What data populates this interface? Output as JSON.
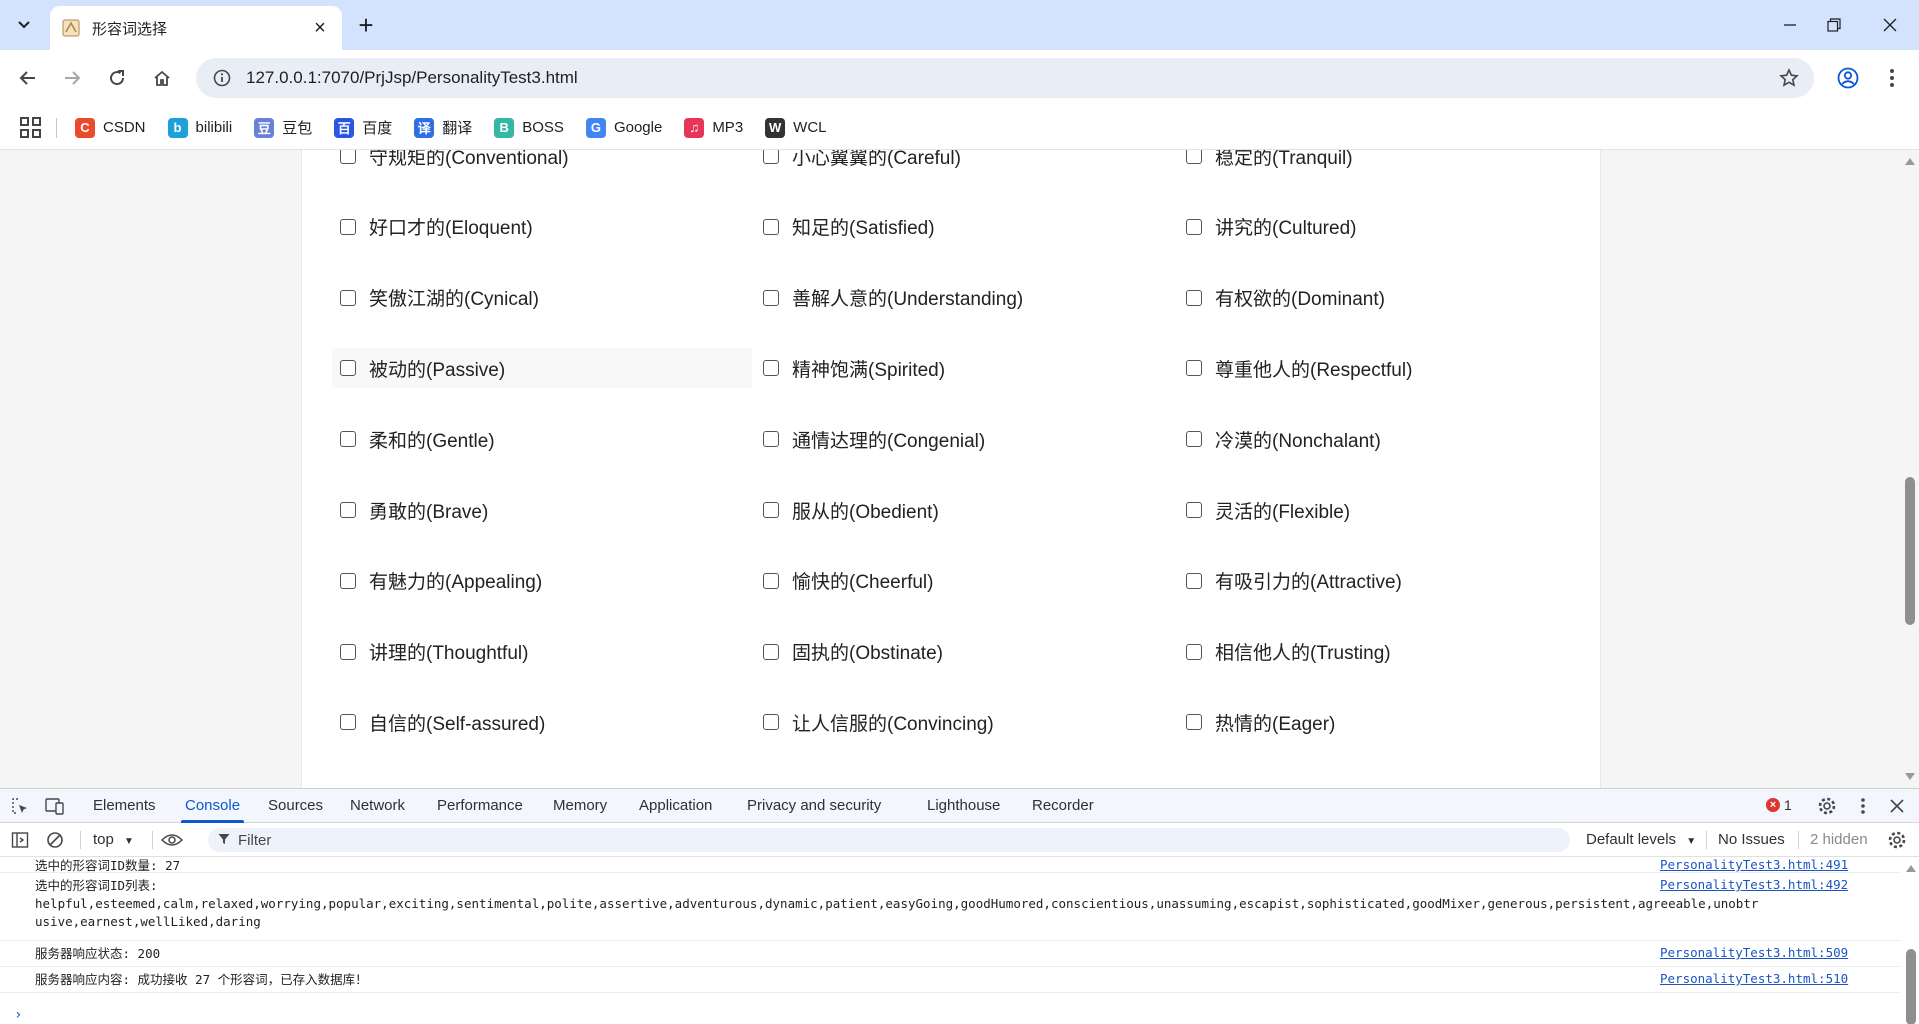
{
  "browser": {
    "tab_title": "形容词选择",
    "url": "127.0.0.1:7070/PrjJsp/PersonalityTest3.html"
  },
  "bookmarks": [
    {
      "label": "CSDN",
      "icon": "csdn-icon",
      "color": "#e94b2b",
      "glyph": "C"
    },
    {
      "label": "bilibili",
      "icon": "bilibili-icon",
      "color": "#1ea0d8",
      "glyph": "b"
    },
    {
      "label": "豆包",
      "icon": "doubao-icon",
      "color": "#6b7fd6",
      "glyph": "豆"
    },
    {
      "label": "百度",
      "icon": "baidu-icon",
      "color": "#2a55e5",
      "glyph": "百"
    },
    {
      "label": "翻译",
      "icon": "translate-icon",
      "color": "#2f6fe4",
      "glyph": "译"
    },
    {
      "label": "BOSS",
      "icon": "boss-icon",
      "color": "#33b7a6",
      "glyph": "B"
    },
    {
      "label": "Google",
      "icon": "google-icon",
      "color": "#4285f4",
      "glyph": "G"
    },
    {
      "label": "MP3",
      "icon": "music-icon",
      "color": "#e8365a",
      "glyph": "♫"
    },
    {
      "label": "WCL",
      "icon": "wcl-icon",
      "color": "#333333",
      "glyph": "W"
    }
  ],
  "adjectives": [
    [
      "守规矩的(Conventional)",
      "小心翼翼的(Careful)",
      "稳定的(Tranquil)"
    ],
    [
      "好口才的(Eloquent)",
      "知足的(Satisfied)",
      "讲究的(Cultured)"
    ],
    [
      "笑傲江湖的(Cynical)",
      "善解人意的(Understanding)",
      "有权欲的(Dominant)"
    ],
    [
      "被动的(Passive)",
      "精神饱满(Spirited)",
      "尊重他人的(Respectful)"
    ],
    [
      "柔和的(Gentle)",
      "通情达理的(Congenial)",
      "冷漠的(Nonchalant)"
    ],
    [
      "勇敢的(Brave)",
      "服从的(Obedient)",
      "灵活的(Flexible)"
    ],
    [
      "有魅力的(Appealing)",
      "愉快的(Cheerful)",
      "有吸引力的(Attractive)"
    ],
    [
      "讲理的(Thoughtful)",
      "固执的(Obstinate)",
      "相信他人的(Trusting)"
    ],
    [
      "自信的(Self-assured)",
      "让人信服的(Convincing)",
      "热情的(Eager)"
    ]
  ],
  "devtools": {
    "tabs": [
      "Elements",
      "Console",
      "Sources",
      "Network",
      "Performance",
      "Memory",
      "Application",
      "Privacy and security",
      "Lighthouse",
      "Recorder"
    ],
    "active_tab": "Console",
    "error_count": "1",
    "context": "top",
    "filter_placeholder": "Filter",
    "levels": "Default levels",
    "issues": "No Issues",
    "hidden": "2 hidden",
    "logs": [
      {
        "text": "选中的形容词ID数量: 27",
        "source": "PersonalityTest3.html:491"
      },
      {
        "text": "选中的形容词ID列表:\nhelpful,esteemed,calm,relaxed,worrying,popular,exciting,sentimental,polite,assertive,adventurous,dynamic,patient,easyGoing,goodHumored,conscientious,unassuming,escapist,sophisticated,goodMixer,generous,persistent,agreeable,unobtr\nusive,earnest,wellLiked,daring",
        "source": "PersonalityTest3.html:492"
      },
      {
        "text": "服务器响应状态: 200",
        "source": "PersonalityTest3.html:509"
      },
      {
        "text": "服务器响应内容: 成功接收 27 个形容词，已存入数据库！",
        "source": "PersonalityTest3.html:510"
      }
    ]
  }
}
